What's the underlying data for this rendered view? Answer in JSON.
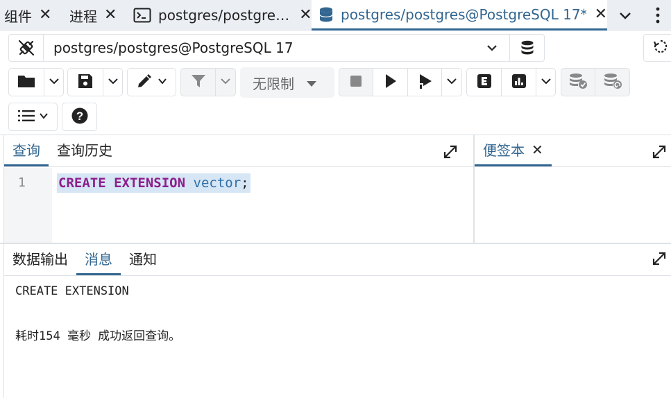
{
  "tabs": [
    {
      "label": "组件",
      "closable": true,
      "active": false
    },
    {
      "label": "进程",
      "closable": true,
      "active": false
    },
    {
      "label": "postgres/postgre…",
      "closable": true,
      "active": false,
      "icon": "terminal-icon"
    },
    {
      "label": "postgres/postgres@PostgreSQL 17*",
      "closable": true,
      "active": true,
      "icon": "database-icon"
    }
  ],
  "tabbar_icons": [
    "chevron-down-icon",
    "kebab-menu-icon"
  ],
  "connection": {
    "label": "postgres/postgres@PostgreSQL 17",
    "status_icon": "disconnected-plug-icon"
  },
  "toolbar": {
    "limit_label": "无限制",
    "buttons": [
      "folder-icon",
      "save-icon",
      "edit-pencil-icon",
      "filter-icon",
      "stop-icon",
      "play-icon",
      "play-script-icon",
      "explain-E-icon",
      "explain-analyze-icon",
      "commit-icon",
      "rollback-icon",
      "format-list-icon",
      "help-icon"
    ]
  },
  "query_pane": {
    "tabs": [
      {
        "label": "查询",
        "active": true
      },
      {
        "label": "查询历史",
        "active": false
      }
    ],
    "line_number": "1",
    "code": {
      "kw1": "CREATE",
      "kw2": "EXTENSION",
      "ident": "vector",
      "punct": ";"
    }
  },
  "scratch_pane": {
    "label": "便签本",
    "closable": true
  },
  "output_pane": {
    "tabs": [
      {
        "label": "数据输出",
        "active": false
      },
      {
        "label": "消息",
        "active": true
      },
      {
        "label": "通知",
        "active": false
      }
    ],
    "messages": [
      "CREATE EXTENSION",
      "耗时154 毫秒 成功返回查询。"
    ]
  },
  "colors": {
    "accent": "#326690",
    "keyword": "#8c1f8c",
    "identifier": "#2d6fa8",
    "selection": "#d7e6f5",
    "tabbar_bg": "#ebeef3"
  }
}
